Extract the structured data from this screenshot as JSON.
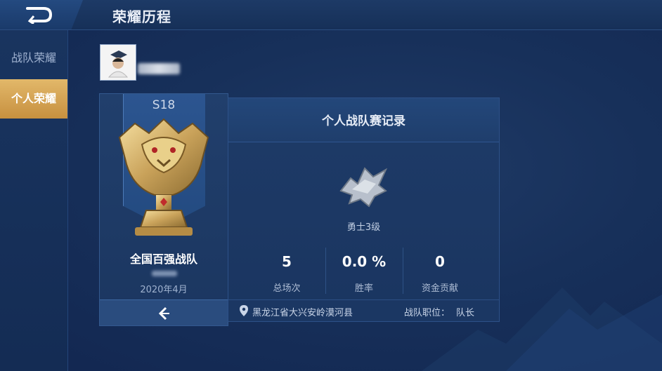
{
  "header": {
    "title": "荣耀历程",
    "back_icon": "back-arrow-icon"
  },
  "sidebar": {
    "items": [
      {
        "label": "战队荣耀",
        "active": false
      },
      {
        "label": "个人荣耀",
        "active": true
      }
    ]
  },
  "profile": {
    "avatar_icon": "user-avatar"
  },
  "trophy_card": {
    "season": "S18",
    "team_title": "全国百强战队",
    "date": "2020年4月",
    "footer_icon": "chevron-left-icon"
  },
  "record": {
    "title": "个人战队赛记录",
    "rank_name": "勇士3级",
    "stats": [
      {
        "value": "5",
        "label": "总场次"
      },
      {
        "value": "0.0 %",
        "label": "胜率"
      },
      {
        "value": "0",
        "label": "资金贡献"
      }
    ],
    "location": "黑龙江省大兴安岭漠河县",
    "role_label": "战队职位：",
    "role_value": "队长"
  },
  "colors": {
    "active_tab": "#d4a252",
    "background": "#17305a",
    "gold": "#c9a25a"
  }
}
